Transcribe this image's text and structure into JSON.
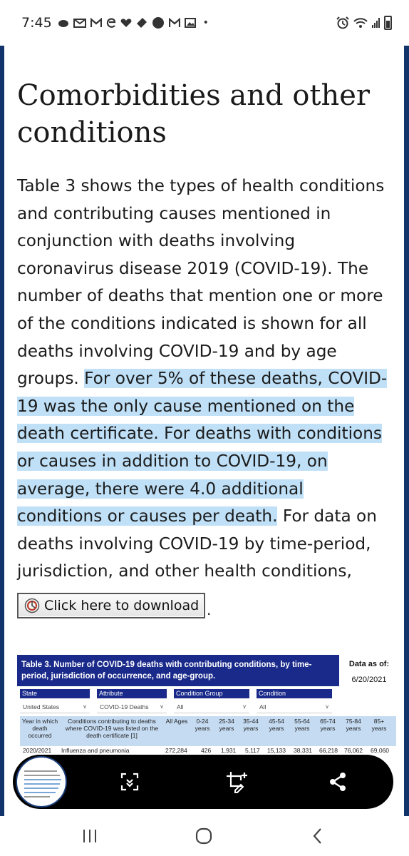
{
  "status_bar": {
    "time": "7:45",
    "left_icons": [
      "tea-icon",
      "mail-icon",
      "gmail-icon",
      "edge-icon",
      "heart-icon",
      "tag-icon",
      "circle-icon",
      "gmail-icon",
      "photo-icon",
      "dot-icon"
    ],
    "right_icons": [
      "alarm-icon",
      "wifi-icon",
      "signal-icon",
      "battery-icon"
    ]
  },
  "article": {
    "heading": "Comorbidities and other conditions",
    "paragraph_plain_1": "Table 3 shows the types of health conditions and contributing causes mentioned in conjunction with deaths involving coronavirus disease 2019 (COVID-19). The number of deaths that mention one or more of the conditions indicated is shown for all deaths involving COVID-19 and by age groups. ",
    "paragraph_highlighted": "For over 5% of these deaths, COVID-19 was the only cause mentioned on the death certificate. For deaths with conditions or causes in addition to COVID-19, on average, there were 4.0 additional conditions or causes per death.",
    "paragraph_plain_2": " For data on deaths involving COVID-19 by time-period, jurisdiction, and other health conditions,",
    "download_label": "Click here to download",
    "trailing_punct": "."
  },
  "table_image": {
    "title": "Table 3. Number of COVID-19 deaths with contributing conditions, by time-period, jurisdiction of occurrence, and age-group.",
    "as_of_label": "Data as of:",
    "as_of_date": "6/20/2021",
    "filters": [
      {
        "label": "State",
        "value": "United States"
      },
      {
        "label": "Attribute",
        "value": "COVID-19 Deaths"
      },
      {
        "label": "Condition Group",
        "value": "All"
      },
      {
        "label": "Condition",
        "value": "All"
      }
    ],
    "columns": [
      "Year in which death occurred",
      "Conditions contributing to deaths where COVID-19 was listed on the death certificate [1]",
      "All Ages",
      "0-24 years",
      "25-34 years",
      "35-44 years",
      "45-54 years",
      "55-64 years",
      "65-74 years",
      "75-84 years",
      "85+ years"
    ],
    "row": [
      "2020/2021",
      "Influenza and pneumonia",
      "272,284",
      "426",
      "1,931",
      "5,117",
      "15,133",
      "38,331",
      "66,218",
      "76,062",
      "69,060"
    ]
  },
  "overlay_bar": {
    "buttons": [
      "scroll-capture-icon",
      "crop-edit-icon",
      "share-icon"
    ]
  },
  "nav_bar": {
    "buttons": [
      "recent-apps-icon",
      "home-icon",
      "back-icon"
    ]
  }
}
